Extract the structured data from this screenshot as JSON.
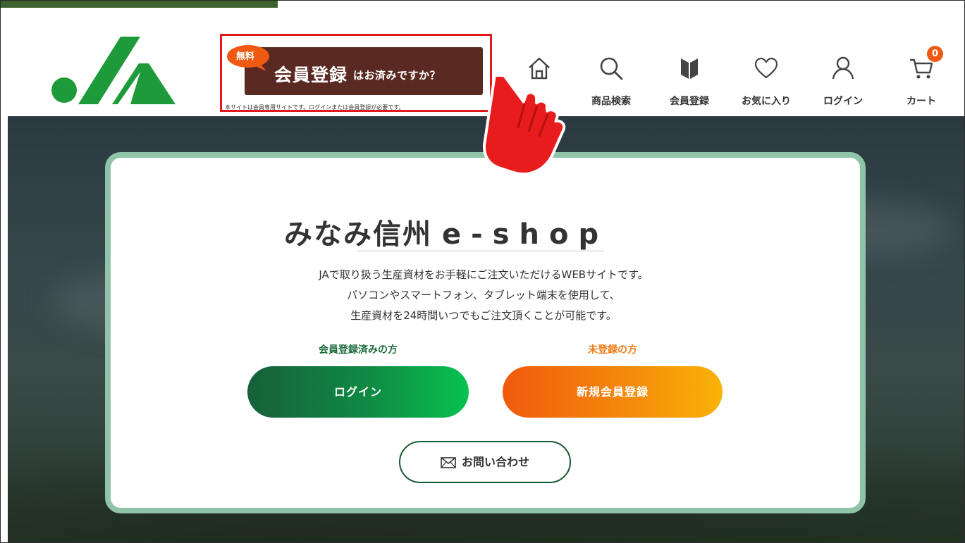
{
  "header": {
    "logo_alt": "JA",
    "register_promo": {
      "badge": "無料",
      "main": "会員登録",
      "sub": "はお済みですか？",
      "note": "本サイトは会員専用サイトです。ログインまたは会員登録が必要です。"
    },
    "nav": [
      {
        "label": "",
        "icon": "home-icon"
      },
      {
        "label": "商品検索",
        "icon": "search-icon"
      },
      {
        "label": "会員登録",
        "icon": "member-register-icon"
      },
      {
        "label": "お気に入り",
        "icon": "heart-icon"
      },
      {
        "label": "ログイン",
        "icon": "user-icon"
      },
      {
        "label": "カート",
        "icon": "cart-icon"
      }
    ],
    "cart_count": "0"
  },
  "main": {
    "title_jp": "みなみ信州",
    "title_latin": "e-shop",
    "description": [
      "JAで取り扱う生産資材をお手軽にご注文いただけるWEBサイトです。",
      "パソコンやスマートフォン、タブレット端末を使用して、",
      "生産資材を24時間いつでもご注文頂くことが可能です。"
    ],
    "member_label": "会員登録済みの方",
    "login_button": "ログイン",
    "new_label": "未登録の方",
    "register_button": "新規会員登録",
    "contact_button": "お問い合わせ"
  },
  "colors": {
    "brand_green": "#1a6b3a",
    "brand_orange": "#ef7a12",
    "promo_brown": "#5a2a22",
    "highlight_red": "#e01a1a",
    "card_border": "#8fc4a9"
  }
}
